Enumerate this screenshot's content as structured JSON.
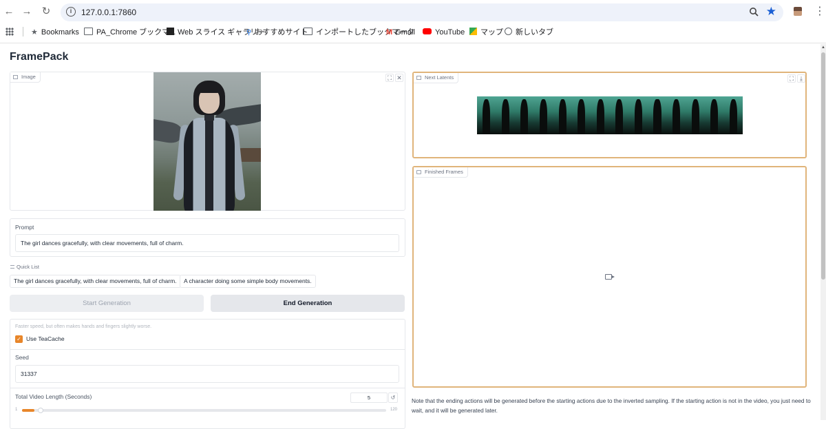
{
  "browser": {
    "url": "127.0.0.1:7860",
    "bookmarks": [
      {
        "label": "Bookmarks",
        "icon": "star-icon"
      },
      {
        "label": "PA_Chrome ブックマ...",
        "icon": "folder-icon"
      },
      {
        "label": "Web スライス ギャラリー",
        "icon": "web-slice-icon"
      },
      {
        "label": "おすすめサイト",
        "icon": "search-icon"
      },
      {
        "label": "インポートしたブックマーク",
        "icon": "folder-icon"
      },
      {
        "label": "Gmail",
        "icon": "gmail-icon"
      },
      {
        "label": "YouTube",
        "icon": "youtube-icon"
      },
      {
        "label": "マップ",
        "icon": "maps-icon"
      },
      {
        "label": "新しいタブ",
        "icon": "globe-icon"
      }
    ]
  },
  "app": {
    "title": "FramePack",
    "image": {
      "label": "Image"
    },
    "prompt": {
      "label": "Prompt",
      "value": "The girl dances gracefully, with clear movements, full of charm."
    },
    "quick_list": {
      "label": "Quick List",
      "items": [
        "The girl dances gracefully, with clear movements, full of charm.",
        "A character doing some simple body movements."
      ]
    },
    "buttons": {
      "start": "Start Generation",
      "end": "End Generation"
    },
    "teacache": {
      "hint": "Faster speed, but often makes hands and fingers slightly worse.",
      "label": "Use TeaCache",
      "checked": true
    },
    "seed": {
      "label": "Seed",
      "value": "31337"
    },
    "video_length": {
      "label": "Total Video Length (Seconds)",
      "value": "5",
      "min": "1",
      "max": "120"
    },
    "next_latents": {
      "label": "Next Latents"
    },
    "finished_frames": {
      "label": "Finished Frames"
    },
    "note": "Note that the ending actions will be generated before the starting actions due to the inverted sampling. If the starting action is not in the video, you just need to wait, and it will be generated later."
  },
  "colors": {
    "accent": "#e8862a",
    "highlight_border": "#e0b47a",
    "omnibox": "#eef2fa",
    "star": "#1a5fd4"
  }
}
